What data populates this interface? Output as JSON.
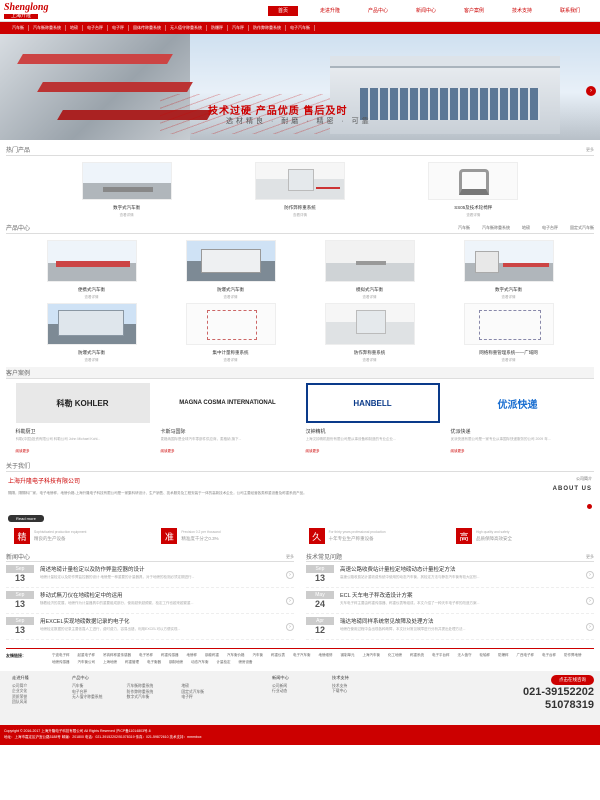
{
  "header": {
    "logo_en": "Shenglong",
    "logo_cn": "上海升隆",
    "nav": [
      "首页",
      "走进升隆",
      "产品中心",
      "新闻中心",
      "客户案例",
      "技术支持",
      "联系我们"
    ]
  },
  "subnav": [
    "汽车衡",
    "汽车衡称重系统",
    "地磅",
    "电子台秤",
    "电子秤",
    "固体传称重系统",
    "无人值守称重系统",
    "防爆秤",
    "汽车秤",
    "防作弊称重系统",
    "电子汽车衡"
  ],
  "banner": {
    "slogan": "技术过硬  产品优质  售后及时",
    "sub": "选材精良 · 耐磨 · 精密 · 可靠"
  },
  "hot": {
    "title": "热门产品",
    "more": "更多",
    "items": [
      {
        "name": "数字式汽车衡",
        "sub": "查看详情"
      },
      {
        "name": "防作弊称重系统",
        "sub": "查看详情"
      },
      {
        "name": "SS05及技术轮椅秤",
        "sub": "查看详情"
      }
    ]
  },
  "products": {
    "title": "产品中心",
    "tabs": [
      "汽车衡",
      "汽车衡称重系统",
      "地磅",
      "电子台秤",
      "固定式汽车衡"
    ],
    "items": [
      {
        "name": "便携式汽车衡",
        "sub": "查看详情"
      },
      {
        "name": "防爆式汽车衡",
        "sub": "查看详情"
      },
      {
        "name": "模拟式汽车衡",
        "sub": "查看详情"
      },
      {
        "name": "数字式汽车衡",
        "sub": "查看详情"
      },
      {
        "name": "防爆式汽车衡",
        "sub": "查看详情"
      },
      {
        "name": "集中计量称重系统",
        "sub": "查看详情"
      },
      {
        "name": "防作弊称重系统",
        "sub": "查看详情"
      },
      {
        "name": "网络称重管理系统——广域网",
        "sub": "查看详情"
      }
    ]
  },
  "cases": {
    "title": "客户案例",
    "items": [
      {
        "logo": "科勒 KOHLER",
        "name": "科勒厨卫",
        "desc": "科勒(中国)投资有限公司 科勒公司 John Michael Kohl...",
        "more": "阅读更多"
      },
      {
        "logo": "MAGNA COSMA INTERNATIONAL",
        "name": "卡斯马国际",
        "desc": "麦格纳国际是全球汽车零部件供应商，麦格纳 旗下...",
        "more": "阅读更多"
      },
      {
        "logo": "HANBELL",
        "name": "汉钟精机",
        "desc": "上海汉钟精机股份有限公司是从事设备和制造的专业企业...",
        "more": "阅读更多"
      },
      {
        "logo": "优派快递",
        "name": "优派快递",
        "desc": "优派快递有限公司是一家专业从事国际快递服务的公司 2009 年...",
        "more": "阅读更多"
      }
    ]
  },
  "about": {
    "title": "关于我们",
    "company": "上海升隆电子科技有限公司",
    "intro": "隔隔，隔隔料厂家，电子地磅秤，地磅价格-上海升隆电子科技有限公司是一家集科研设计、生产销售、技术服务及工程安装于一体的高新技术企业，公司主要经营各类称重设备及称重系统产品。",
    "readmore": "Read more",
    "right_label": "公司简介",
    "right_en": "ABOUT US",
    "slogans": [
      {
        "ch": "精",
        "en": "Sophisticated production equipment",
        "cn": "精良的生产设备"
      },
      {
        "ch": "准",
        "en": "Precision 0.2 per thousand",
        "cn": "精准度千分之0.3%"
      },
      {
        "ch": "久",
        "en": "For thirty years professional production",
        "cn": "十年专业生产称重设备"
      },
      {
        "ch": "高",
        "en": "High quality and safety",
        "cn": "品质保障高效安全"
      }
    ]
  },
  "news": {
    "title": "新闻中心",
    "more": "更多",
    "items": [
      {
        "m": "Sep",
        "d": "13",
        "h": "简述地磅计量检定以及防作弊监控器的设计",
        "p": "地磅计量检定以及防作弊监控器的设计 地磅是一种重要的计量器具，对于地磅的检测必须定期进行..."
      },
      {
        "m": "Sep",
        "d": "13",
        "h": "移动式無刀仪在地磅检定中的运用",
        "p": "随着经济的发展，地磅作为计量器具中的重要组成部分，使用越来越频繁，检定工作也越来越繁重..."
      },
      {
        "m": "Sep",
        "d": "13",
        "h": "用EXCEL实现地磅数据记录的电子化",
        "p": "地磅检定数据的记录主要依靠人工进行，费时费力，容易出错，利用EXCEL可以方便实现..."
      }
    ]
  },
  "faq": {
    "title": "技术常见问题",
    "more": "更多",
    "items": [
      {
        "m": "Sep",
        "d": "13",
        "h": "高速公路收费站计量检定地磅动态计量检定方法",
        "p": "高速公路收费站计重收费系统中使用的动态汽车衡，其检定方法与静态汽车衡有较大区别..."
      },
      {
        "m": "May",
        "d": "24",
        "h": "ECL 天车电子秤改造设计方案",
        "p": "天车电子秤主要由称重传感器、称重仪表等组成，本文介绍了一种天车电子秤的改造方案..."
      },
      {
        "m": "Apr",
        "d": "12",
        "h": "瑞达地磅同样系统常见故障及处理方法",
        "p": "地磅在使用过程中会出现各种故障，本文针对常见故障进行分析并提出处理方法..."
      }
    ]
  },
  "links": {
    "label": "友情链接：",
    "items": [
      "宁波电子秤",
      "起重电子秤",
      "吊钩秤称重传感器",
      "电子吊秤",
      "称重传感器",
      "地磅秤",
      "钢卷称重",
      "汽车衡价格",
      "汽车衡",
      "称重仪表",
      "电子汽车衡",
      "地磅维修",
      "钢制单元",
      "上海汽车衡",
      "化工地磅",
      "称重系统",
      "电子平台秤",
      "无人值守",
      "轮轴秤",
      "防爆秤",
      "广西电子秤",
      "电子台秤",
      "防作弊地磅",
      "地磅传感器",
      "汽车衡公司",
      "上海地磅",
      "称重管理",
      "电子衡器",
      "钢制地磅",
      "动态汽车衡",
      "计量检定",
      "磅房设备"
    ]
  },
  "footer": {
    "col1": {
      "h": "走进升隆",
      "items": [
        "公司简介",
        "企业文化",
        "资质荣誉",
        "团队风采"
      ]
    },
    "col2": {
      "h": "产品中心",
      "items": [
        "汽车衡",
        "汽车衡称重系统",
        "地磅",
        "电子台秤",
        "防作弊称重系统",
        "固定式汽车衡",
        "无人值守称重系统",
        "数字式汽车衡",
        "电子秤"
      ]
    },
    "col3": {
      "h": "新闻中心",
      "items": [
        "公司新闻",
        "行业动态"
      ]
    },
    "col4": {
      "h": "技术支持",
      "items": [
        "技术支持",
        "下载中心"
      ]
    },
    "consult": "点击在线咨询",
    "phone1": "021-39152202",
    "phone2": "51078319"
  },
  "copyright": {
    "line1": "Copyright © 2016-2017 上海升隆电子科技有限公司 All Rights Reserved  沪ICP备11014803号-6",
    "line2": "地址：上海市嘉定区沪宜公路3188号  邮编：201800  电话：021-39152202/51078319  传真：021-59872610  技术支持：mmmbox"
  }
}
